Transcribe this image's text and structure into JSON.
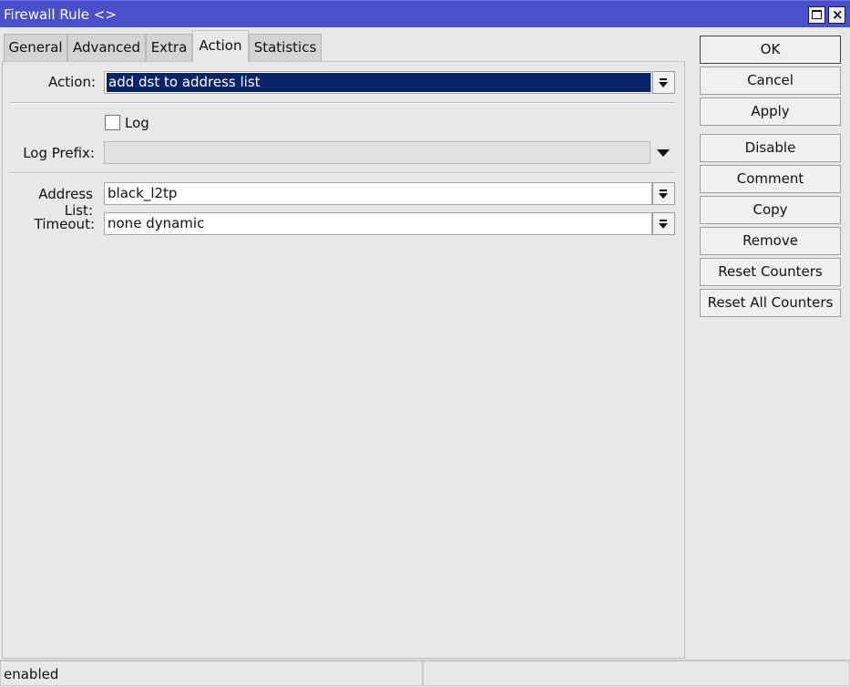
{
  "window": {
    "title": "Firewall Rule <>",
    "maximize_icon": "maximize-icon",
    "close_icon": "close-icon",
    "close_glyph": "×"
  },
  "tabs": [
    {
      "label": "General"
    },
    {
      "label": "Advanced"
    },
    {
      "label": "Extra"
    },
    {
      "label": "Action",
      "active": true
    },
    {
      "label": "Statistics"
    }
  ],
  "form": {
    "action_label": "Action:",
    "action_value": "add dst to address list",
    "log_label": "Log",
    "log_checked": false,
    "log_prefix_label": "Log Prefix:",
    "log_prefix_value": "",
    "address_list_label": "Address List:",
    "address_list_value": "black_l2tp",
    "timeout_label": "Timeout:",
    "timeout_value": "none dynamic"
  },
  "buttons": {
    "ok": "OK",
    "cancel": "Cancel",
    "apply": "Apply",
    "disable": "Disable",
    "comment": "Comment",
    "copy": "Copy",
    "remove": "Remove",
    "reset_counters": "Reset Counters",
    "reset_all_counters": "Reset All Counters"
  },
  "status": {
    "left": "enabled",
    "right": ""
  },
  "colors": {
    "titlebar": "#4a50cc",
    "selection": "#0a246a"
  }
}
